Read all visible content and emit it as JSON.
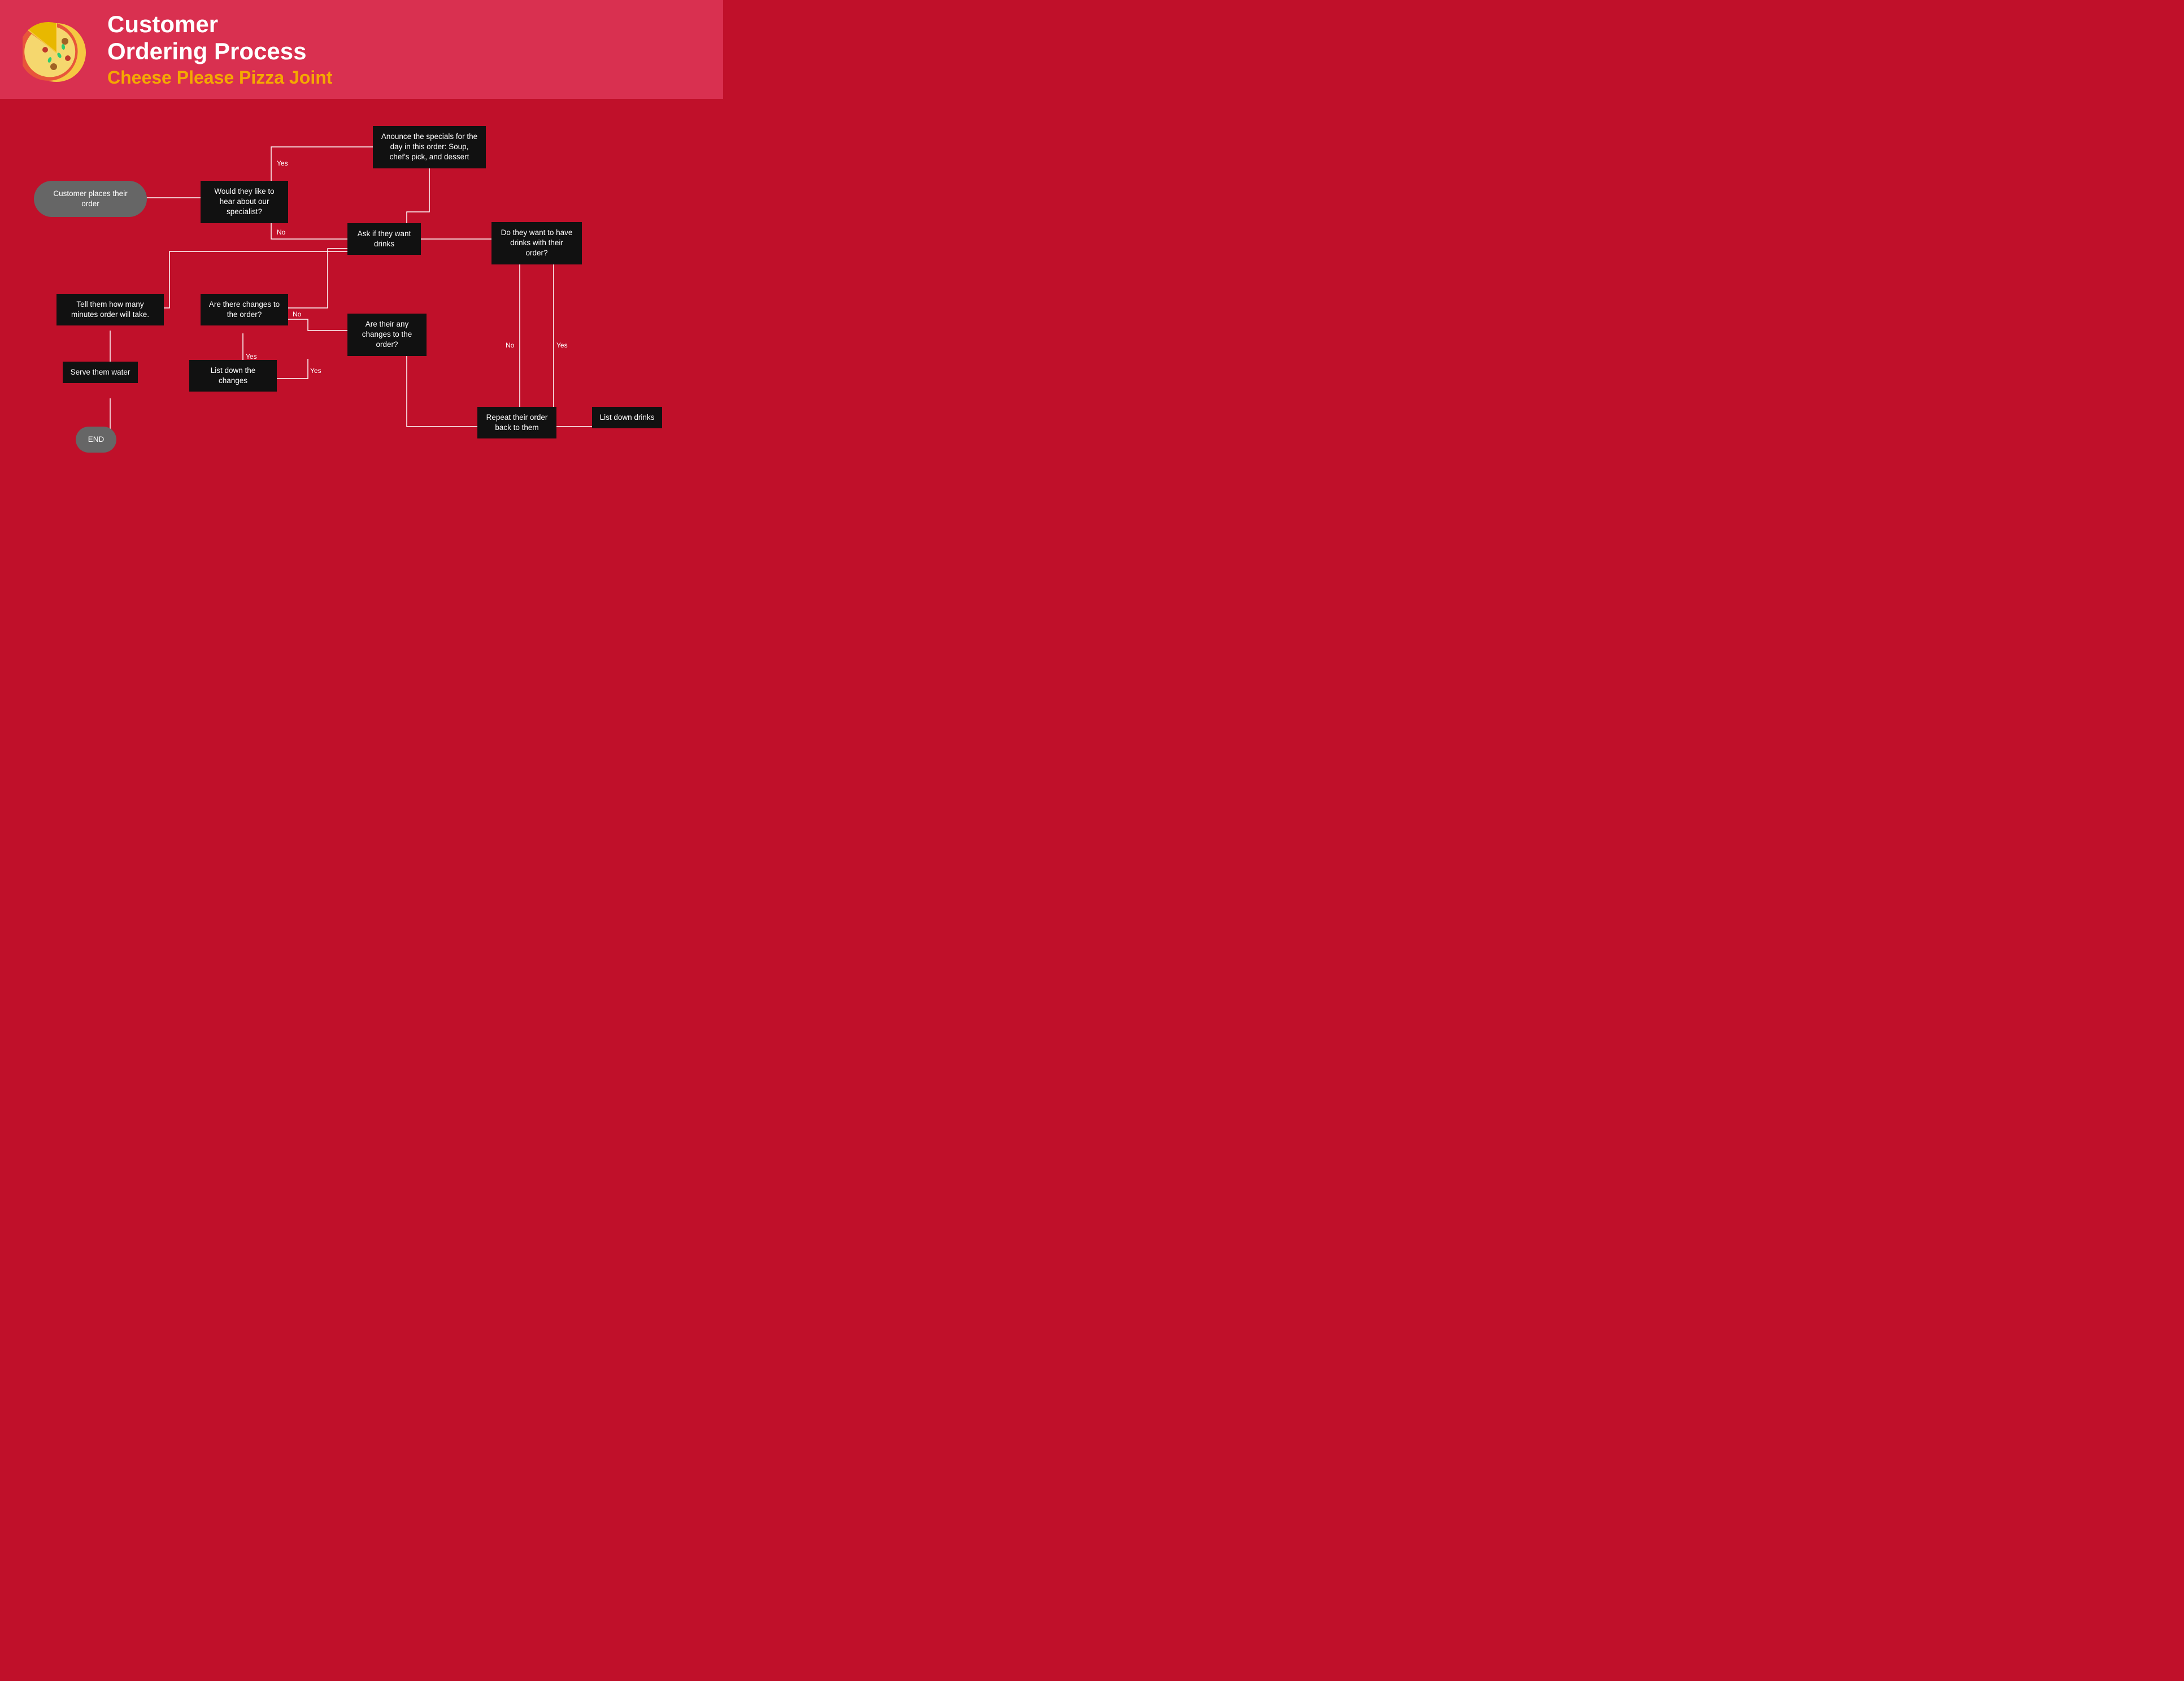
{
  "header": {
    "title_line1": "Customer",
    "title_line2": "Ordering Process",
    "subtitle": "Cheese Please Pizza Joint"
  },
  "nodes": {
    "start": "Customer places their order",
    "specialist": "Would they like to hear about our specialist?",
    "announce": "Anounce the specials for the day in this order: Soup, chef's pick, and dessert",
    "ask_drinks": "Ask if they want drinks",
    "do_drinks": "Do they want to have drinks with their order?",
    "tell_minutes": "Tell them how many minutes order will take.",
    "changes1": "Are there changes to the order?",
    "changes2": "Are their any changes to the order?",
    "list_changes": "List down the changes",
    "repeat_order": "Repeat their order back to them",
    "list_drinks": "List down drinks",
    "serve_water": "Serve them water",
    "end": "END"
  },
  "labels": {
    "yes": "Yes",
    "no": "No"
  }
}
